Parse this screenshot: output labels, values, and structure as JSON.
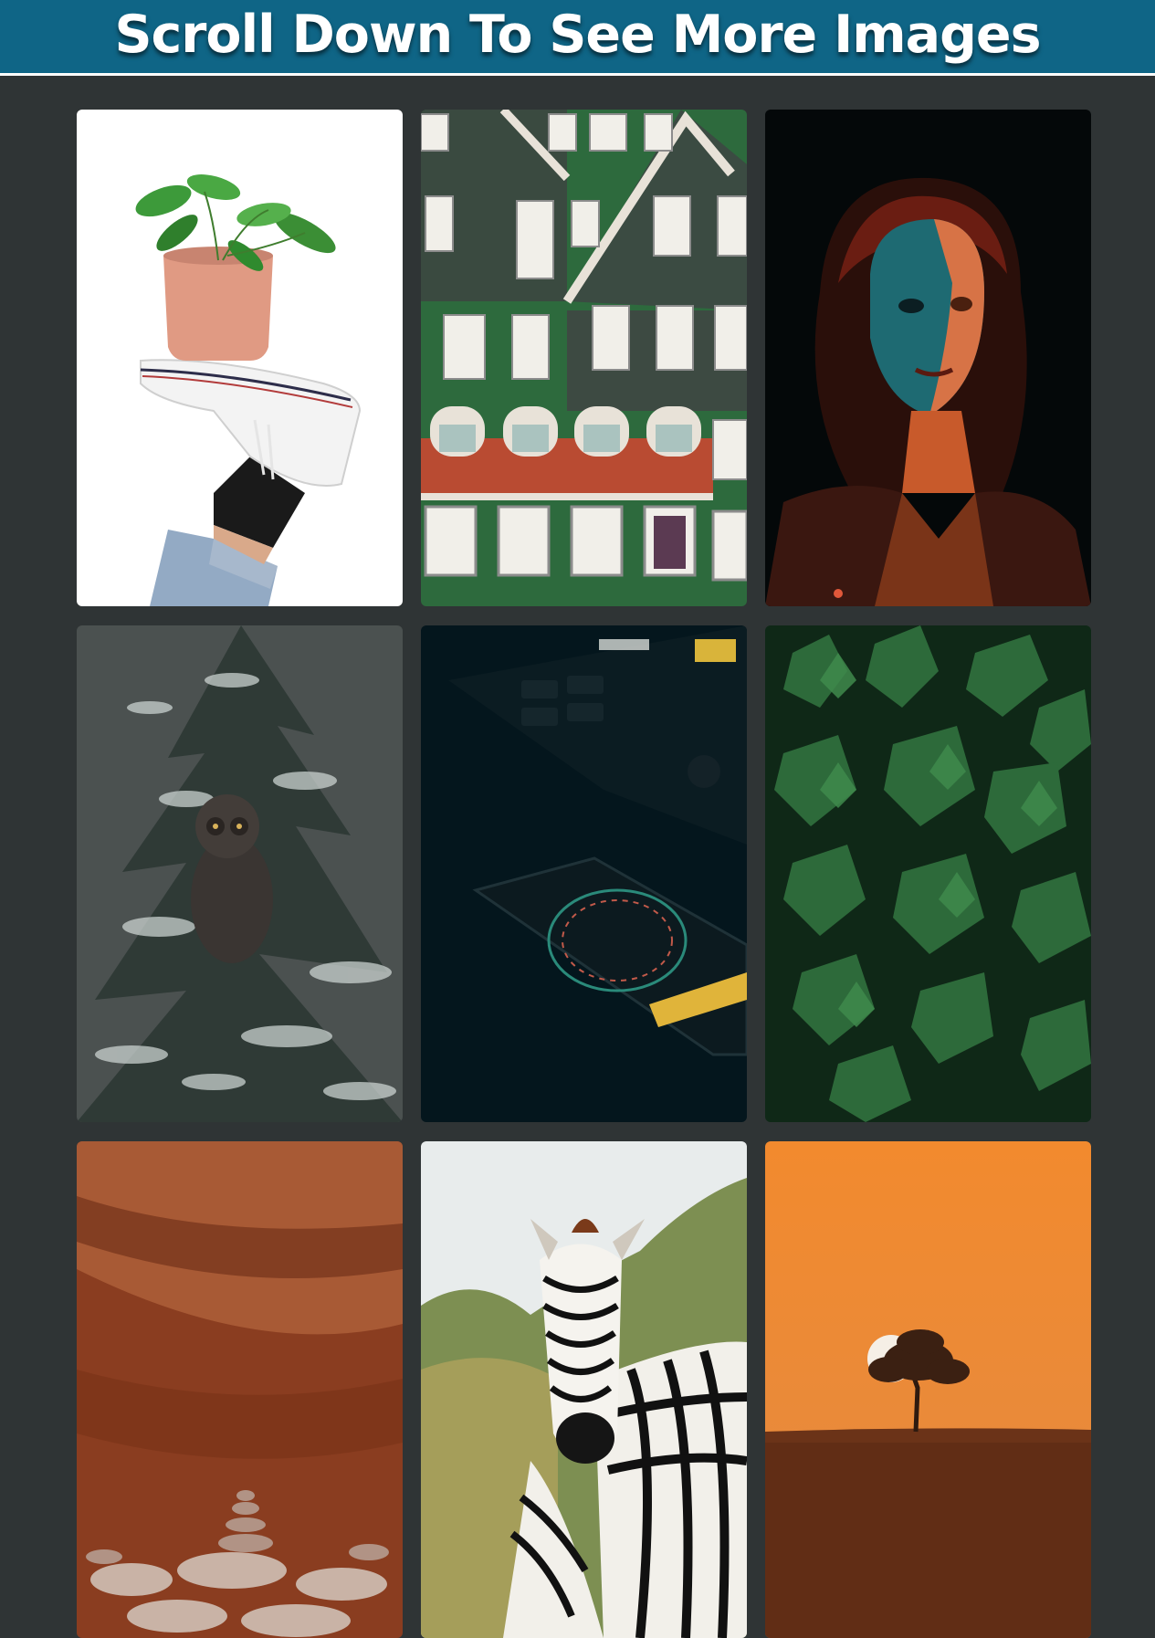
{
  "header": {
    "title": "Scroll Down To See More Images",
    "background": "#0f6586"
  },
  "page": {
    "background": "#2f3435"
  },
  "gallery": {
    "images": [
      {
        "subject": "plant-pot-on-sneaker"
      },
      {
        "subject": "green-dutch-houses"
      },
      {
        "subject": "woman-portrait-red-teal-light"
      },
      {
        "subject": "owl-in-snowy-pine"
      },
      {
        "subject": "music-controller-and-phone"
      },
      {
        "subject": "green-leaves"
      },
      {
        "subject": "red-canyon-cairns"
      },
      {
        "subject": "zebra"
      },
      {
        "subject": "sunset-tree-orange-sky"
      }
    ]
  }
}
